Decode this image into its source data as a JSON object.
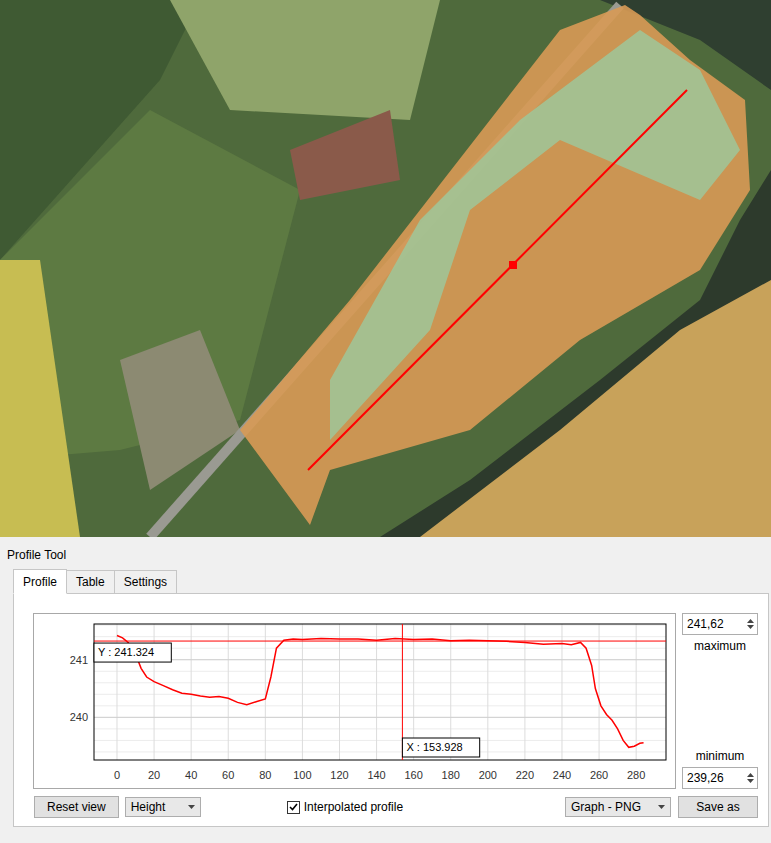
{
  "window": {
    "title": "Profile Tool"
  },
  "tabs": [
    {
      "label": "Profile",
      "selected": true
    },
    {
      "label": "Table",
      "selected": false
    },
    {
      "label": "Settings",
      "selected": false
    }
  ],
  "chart": {
    "x_ticks": [
      "0",
      "20",
      "40",
      "60",
      "80",
      "100",
      "120",
      "140",
      "160",
      "180",
      "200",
      "220",
      "240",
      "260",
      "280"
    ],
    "y_ticks": [
      "240",
      "241"
    ],
    "x_range": [
      -12.4,
      296.1
    ],
    "y_range": [
      239.26,
      241.62
    ],
    "series": [
      {
        "name": "profile",
        "color": "#ff0000",
        "x": [
          0,
          3,
          6,
          10,
          13,
          16,
          20,
          25,
          30,
          35,
          40,
          45,
          50,
          55,
          60,
          65,
          70,
          75,
          80,
          83,
          86,
          90,
          95,
          100,
          110,
          120,
          130,
          140,
          150,
          160,
          170,
          180,
          190,
          200,
          210,
          220,
          230,
          240,
          245,
          250,
          253,
          256,
          258,
          261,
          264,
          267,
          270,
          273,
          276,
          279,
          282,
          284
        ],
        "values": [
          241.42,
          241.38,
          241.3,
          241.1,
          240.85,
          240.7,
          240.62,
          240.55,
          240.48,
          240.42,
          240.4,
          240.37,
          240.35,
          240.36,
          240.33,
          240.26,
          240.22,
          240.27,
          240.32,
          240.7,
          241.2,
          241.34,
          241.36,
          241.35,
          241.37,
          241.36,
          241.36,
          241.34,
          241.37,
          241.35,
          241.36,
          241.33,
          241.34,
          241.33,
          241.32,
          241.3,
          241.27,
          241.28,
          241.26,
          241.3,
          241.2,
          240.9,
          240.5,
          240.2,
          240.05,
          239.95,
          239.8,
          239.6,
          239.48,
          239.5,
          239.55,
          239.56
        ]
      }
    ],
    "cursor": {
      "x": 153.928,
      "y": 241.324,
      "x_label": "X : 153.928",
      "y_label": "Y : 241.324"
    }
  },
  "range": {
    "maximum": {
      "value": "241,62",
      "label": "maximum"
    },
    "minimum": {
      "value": "239,26",
      "label": "minimum"
    }
  },
  "controls": {
    "reset": "Reset view",
    "mode": "Height",
    "interpolated": {
      "label": "Interpolated profile",
      "checked": true
    },
    "export": "Graph - PNG",
    "save": "Save as"
  }
}
